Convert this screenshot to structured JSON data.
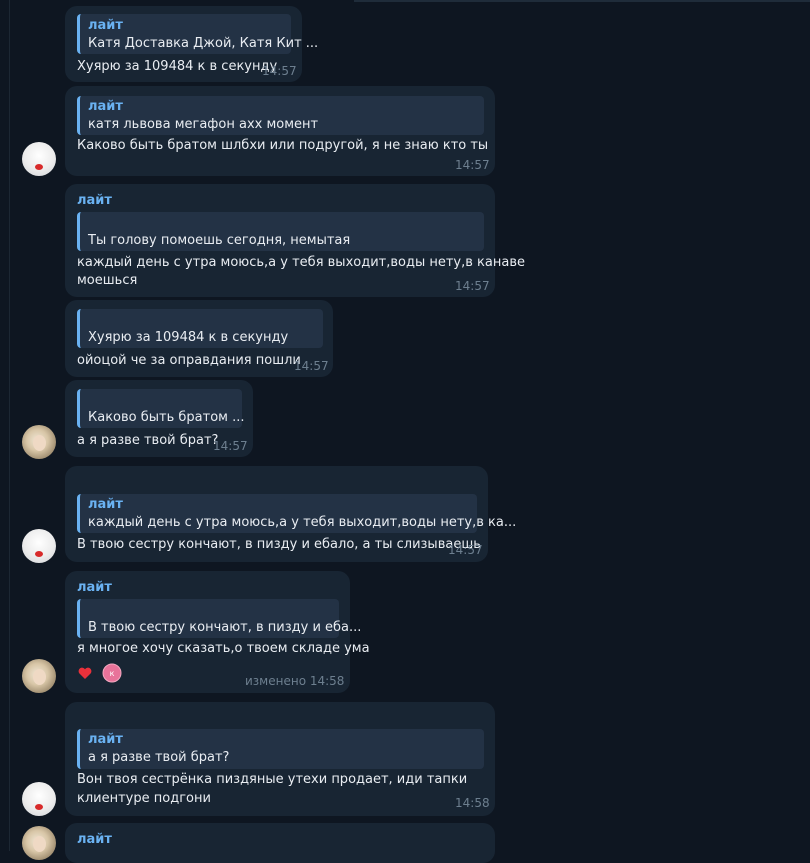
{
  "chat": {
    "messages": [
      {
        "quote_name": "лайт",
        "quote_text": "Катя Доставка Джой, Катя Кит ...",
        "text": [
          "Хуярю за 109484 к в секунду"
        ],
        "time": "14:57"
      },
      {
        "quote_name": "лайт",
        "quote_text": "катя львова мегафон ахх момент",
        "text": [
          "Каково быть братом шлбхи или подругой, я не знаю кто ты"
        ],
        "time": "14:57"
      },
      {
        "sender": "лайт",
        "quote_text": "Ты голову помоешь сегодня, немытая",
        "text": [
          "каждый день с утра моюсь,а у тебя выходит,воды нету,в канаве",
          "моешься"
        ],
        "time": "14:57"
      },
      {
        "quote_text": "Хуярю за 109484 к в секунду",
        "text": [
          "ойоцой че за оправдания пошли"
        ],
        "time": "14:57"
      },
      {
        "quote_text": "Каково быть братом ...",
        "text": [
          "а я разве твой брат?"
        ],
        "time": "14:57"
      },
      {
        "quote_name": "лайт",
        "quote_text": "каждый день с утра моюсь,а у тебя выходит,воды нету,в ка...",
        "text": [
          "В твою сестру кончают, в пизду и ебало, а ты слизываешь"
        ],
        "time": "14:57"
      },
      {
        "sender": "лайт",
        "quote_text": "В твою сестру кончают, в пизду и еба...",
        "text": [
          "я многое хочу сказать,о твоем складе ума"
        ],
        "reactions": [
          "heart",
          "avatar"
        ],
        "reaction_letter": "к",
        "edited": "изменено",
        "time": "14:58"
      },
      {
        "quote_name": "лайт",
        "quote_text": "а я разве твой брат?",
        "text": [
          "Вон твоя сестрёнка пиздяные утехи продает, иди тапки",
          "клиентуре подгони"
        ],
        "time": "14:58"
      },
      {
        "sender": "лайт"
      }
    ]
  },
  "colors": {
    "background": "#0e1621",
    "bubble": "#182533",
    "accent": "#6ab2f2",
    "time": "#6d7f8f",
    "reaction_heart": "#e8313b",
    "reaction_avatar": "#e8739a"
  },
  "icons": [
    "heart-icon",
    "reaction-avatar-icon"
  ]
}
